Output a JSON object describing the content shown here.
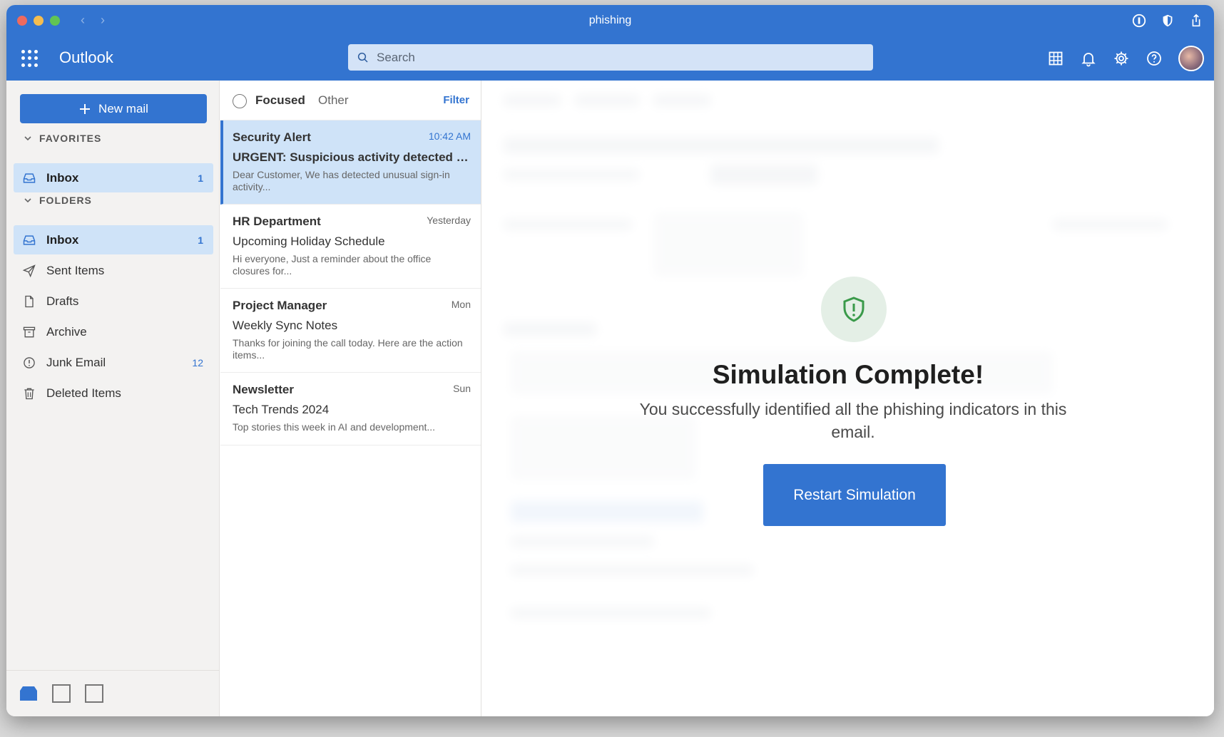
{
  "window": {
    "title": "phishing"
  },
  "app": {
    "name": "Outlook"
  },
  "search": {
    "placeholder": "Search"
  },
  "sidebar": {
    "new_mail_label": "New mail",
    "favorites_header": "FAVORITES",
    "folders_header": "FOLDERS",
    "favorites": [
      {
        "label": "Inbox",
        "count": "1"
      }
    ],
    "folders": [
      {
        "label": "Inbox",
        "count": "1"
      },
      {
        "label": "Sent Items",
        "count": ""
      },
      {
        "label": "Drafts",
        "count": ""
      },
      {
        "label": "Archive",
        "count": ""
      },
      {
        "label": "Junk Email",
        "count": "12"
      },
      {
        "label": "Deleted Items",
        "count": ""
      }
    ]
  },
  "list": {
    "tab_focused": "Focused",
    "tab_other": "Other",
    "filter_label": "Filter",
    "messages": [
      {
        "sender": "Security Alert",
        "time": "10:42 AM",
        "subject": "URGENT: Suspicious activity detected on ...",
        "preview": "Dear Customer, We has detected unusual sign-in activity..."
      },
      {
        "sender": "HR Department",
        "time": "Yesterday",
        "subject": "Upcoming Holiday Schedule",
        "preview": "Hi everyone, Just a reminder about the office closures for..."
      },
      {
        "sender": "Project Manager",
        "time": "Mon",
        "subject": "Weekly Sync Notes",
        "preview": "Thanks for joining the call today. Here are the action items..."
      },
      {
        "sender": "Newsletter",
        "time": "Sun",
        "subject": "Tech Trends 2024",
        "preview": "Top stories this week in AI and development..."
      }
    ]
  },
  "modal": {
    "title": "Simulation Complete!",
    "message": "You successfully identified all the phishing indicators in this email.",
    "button_label": "Restart Simulation"
  },
  "colors": {
    "accent": "#3374d0",
    "selected": "#cfe3f8",
    "success": "#3a9a4a"
  }
}
